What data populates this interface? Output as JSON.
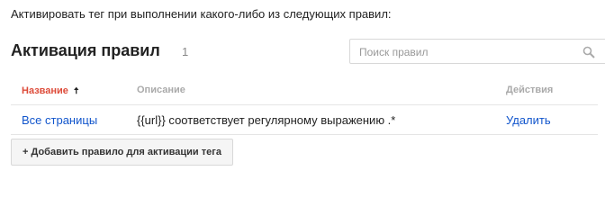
{
  "intro_text": "Активировать тег при выполнении какого-либо из следующих правил:",
  "section": {
    "title": "Активация правил",
    "count": "1"
  },
  "search": {
    "placeholder": "Поиск правил",
    "value": "",
    "icon": "search-icon"
  },
  "table": {
    "headers": {
      "name": "Название",
      "description": "Описание",
      "actions": "Действия"
    },
    "sorted_column": "name",
    "sort_direction": "ascending",
    "sort_arrow": "🠅",
    "sorted_color": "#dd4b39",
    "rows": [
      {
        "name": "Все страницы",
        "description": "{{url}} соответствует регулярному выражению .*",
        "action": "Удалить"
      }
    ]
  },
  "add_button": {
    "label": "+ Добавить правило для активации тега"
  },
  "colors": {
    "link": "#1155cc",
    "header_text": "#aaaaaa"
  }
}
